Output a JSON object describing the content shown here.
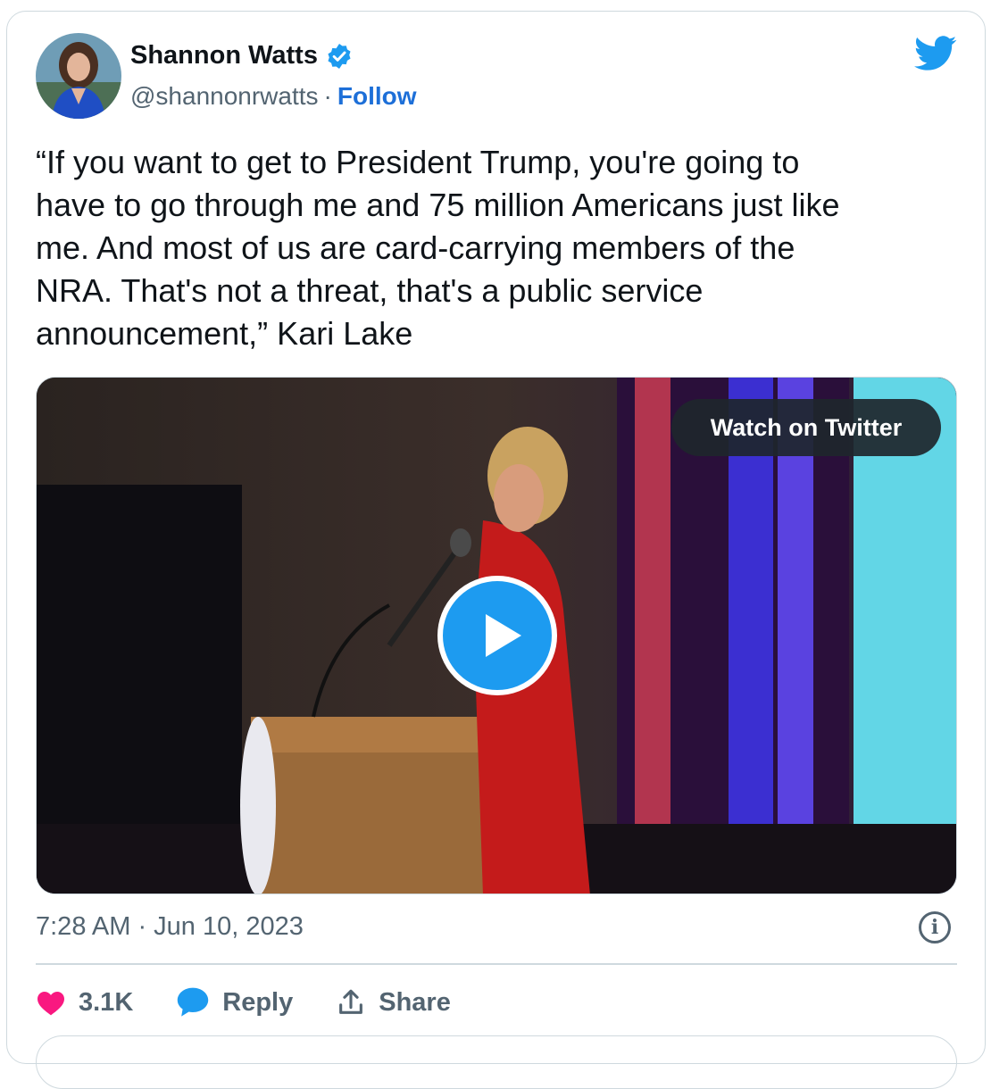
{
  "author": {
    "name": "Shannon Watts",
    "handle": "@shannonrwatts",
    "separator": "·",
    "follow_label": "Follow",
    "verified_icon": "verified-badge-icon"
  },
  "brand_icon": "twitter-bird-icon",
  "tweet": {
    "text": "“If you want to get to President Trump, you're going to\nhave to go through me and 75 million Americans just like\nme. And most of us are card-carrying members of the\nNRA. That's not a threat, that's a public service\nannouncement,” Kari Lake"
  },
  "media": {
    "watch_label": "Watch on Twitter",
    "play_icon": "play-icon"
  },
  "timestamp": "7:28 AM · Jun 10, 2023",
  "info_icon_glyph": "i",
  "actions": {
    "like_count": "3.1K",
    "reply_label": "Reply",
    "share_label": "Share"
  },
  "colors": {
    "accent": "#1d9bf0",
    "follow": "#1d6fd8",
    "like": "#f91880",
    "muted": "#536471",
    "border": "#cfd9de"
  }
}
